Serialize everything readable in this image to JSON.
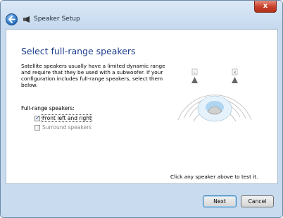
{
  "window": {
    "title": "Speaker Setup",
    "close_label": "x"
  },
  "page": {
    "heading": "Select full-range speakers",
    "description": "Satellite speakers usually have a limited dynamic range and require that they be used with a subwoofer. If your configuration includes full-range speakers, select them below.",
    "section_label": "Full-range speakers:",
    "options": [
      {
        "label": "Front left and right",
        "checked": true,
        "enabled": true
      },
      {
        "label": "Surround speakers",
        "checked": false,
        "enabled": false
      }
    ],
    "diagram_speakers": {
      "left": "L",
      "right": "R"
    },
    "hint": "Click any speaker above to test it."
  },
  "buttons": {
    "next": "Next",
    "cancel": "Cancel"
  }
}
